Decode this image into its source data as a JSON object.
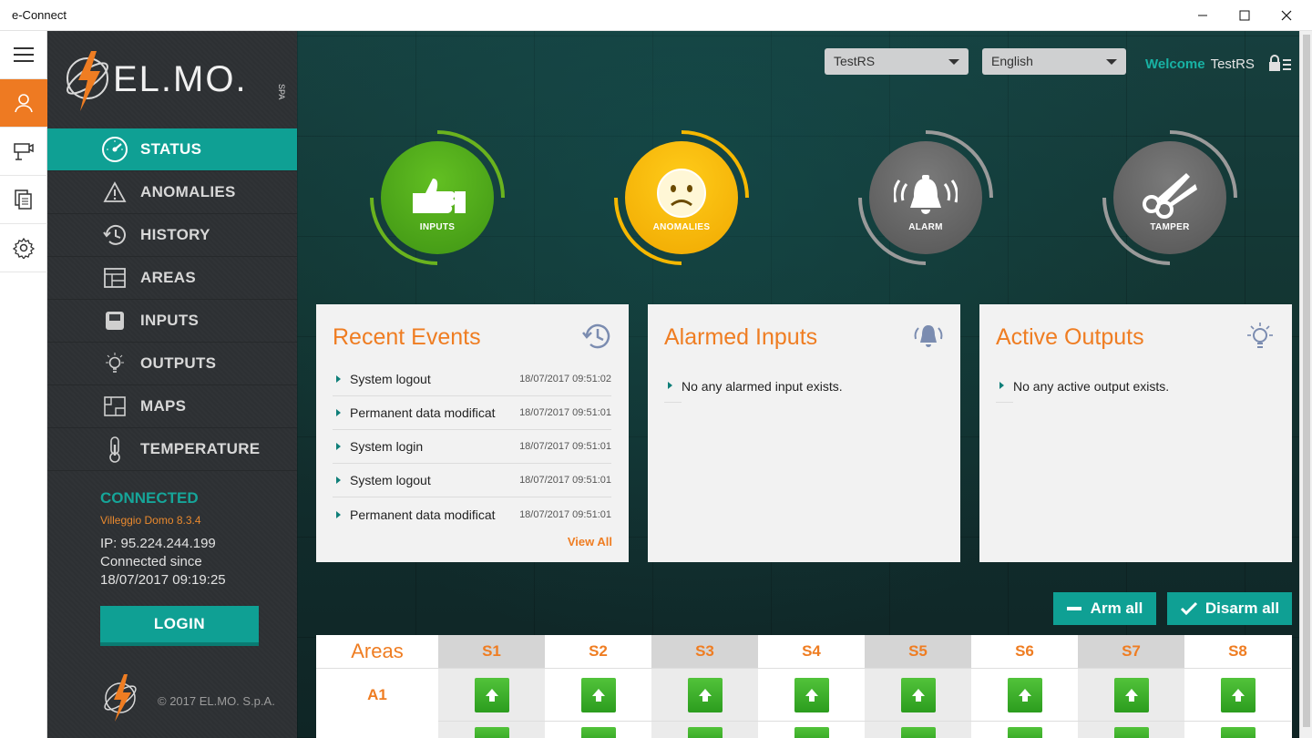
{
  "window": {
    "title": "e-Connect"
  },
  "brand": {
    "logo_text": "EL.MO.",
    "logo_suffix": "SPA"
  },
  "nav": [
    {
      "label": "STATUS",
      "icon": "gauge-icon",
      "active": true
    },
    {
      "label": "ANOMALIES",
      "icon": "warning-icon"
    },
    {
      "label": "HISTORY",
      "icon": "history-icon"
    },
    {
      "label": "AREAS",
      "icon": "areas-icon"
    },
    {
      "label": "INPUTS",
      "icon": "inputs-icon"
    },
    {
      "label": "OUTPUTS",
      "icon": "bulb-icon"
    },
    {
      "label": "MAPS",
      "icon": "map-icon"
    },
    {
      "label": "TEMPERATURE",
      "icon": "thermometer-icon"
    }
  ],
  "connection": {
    "status": "CONNECTED",
    "device": "Villeggio Domo 8.3.4",
    "ip": "IP: 95.224.244.199",
    "since_label": "Connected since",
    "since": "18/07/2017 09:19:25"
  },
  "login_label": "LOGIN",
  "copyright": "© 2017 EL.MO. S.p.A.",
  "header": {
    "site_select": "TestRS",
    "language_select": "English",
    "welcome": "Welcome",
    "user": "TestRS"
  },
  "status_circles": [
    {
      "label": "INPUTS",
      "color": "#4fae1c"
    },
    {
      "label": "ANOMALIES",
      "color": "#f6b800"
    },
    {
      "label": "ALARM",
      "color": "#6b6b6b"
    },
    {
      "label": "TAMPER",
      "color": "#6b6b6b"
    }
  ],
  "panels": {
    "recent": {
      "title": "Recent Events",
      "events": [
        {
          "text": "System logout",
          "time": "18/07/2017 09:51:02"
        },
        {
          "text": "Permanent data modificat",
          "time": "18/07/2017 09:51:01"
        },
        {
          "text": "System login",
          "time": "18/07/2017 09:51:01"
        },
        {
          "text": "System logout",
          "time": "18/07/2017 09:51:01"
        },
        {
          "text": "Permanent data modificat",
          "time": "18/07/2017 09:51:01"
        }
      ],
      "view_all": "View All"
    },
    "alarmed": {
      "title": "Alarmed Inputs",
      "empty": "No any alarmed input exists."
    },
    "outputs": {
      "title": "Active Outputs",
      "empty": "No any active output exists."
    }
  },
  "actions": {
    "arm_all": "Arm all",
    "disarm_all": "Disarm all"
  },
  "areas": {
    "title": "Areas",
    "sectors": [
      "S1",
      "S2",
      "S3",
      "S4",
      "S5",
      "S6",
      "S7",
      "S8"
    ],
    "rows": [
      {
        "name": "A1"
      }
    ]
  },
  "colors": {
    "accent": "#0fa094",
    "orange": "#ef7d22"
  }
}
